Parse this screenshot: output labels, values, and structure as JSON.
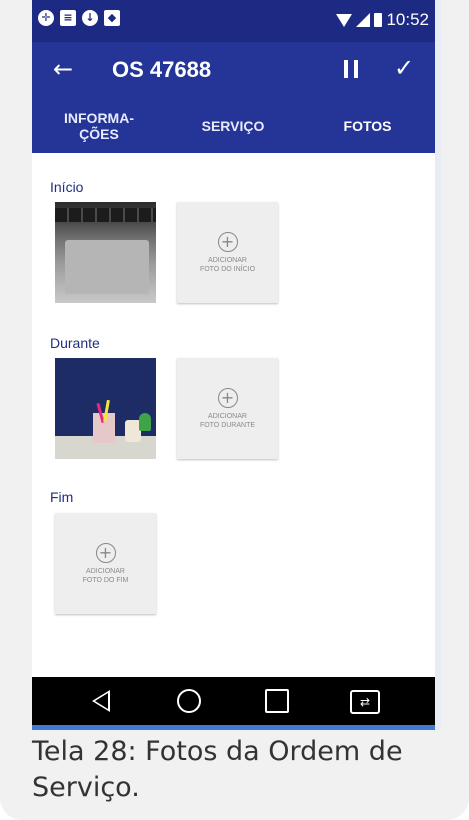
{
  "status_bar": {
    "time": "10:52",
    "left_icons": [
      "tool-icon",
      "menu-icon",
      "download-icon",
      "android-icon"
    ],
    "right_icons": [
      "wifi-icon",
      "signal-icon",
      "battery-icon"
    ]
  },
  "app_bar": {
    "title": "OS 47688",
    "back_icon": "arrow-back-icon",
    "pause_icon": "pause-icon",
    "confirm_icon": "check-icon"
  },
  "tabs": [
    {
      "label": "INFORMA-\nÇÕES",
      "selected": false
    },
    {
      "label": "SERVIÇO",
      "selected": false
    },
    {
      "label": "FOTOS",
      "selected": true
    }
  ],
  "sections": {
    "inicio": {
      "label": "Início",
      "add_label": "ADICIONAR\nFOTO DO INÍCIO"
    },
    "durante": {
      "label": "Durante",
      "add_label": "ADICIONAR\nFOTO DURANTE"
    },
    "fim": {
      "label": "Fim",
      "add_label": "ADICIONAR\nFOTO DO FIM"
    }
  },
  "nav_bar": {
    "icons": [
      "nav-back-icon",
      "nav-home-icon",
      "nav-recents-icon",
      "screen-rotate-icon"
    ]
  },
  "caption": "Tela 28: Fotos da Ordem de Serviço.",
  "colors": {
    "status_bar": "#1c2a83",
    "app_bar": "#253597",
    "tab_indicator": "#9fb6f1",
    "section_label": "#1f2f80"
  }
}
